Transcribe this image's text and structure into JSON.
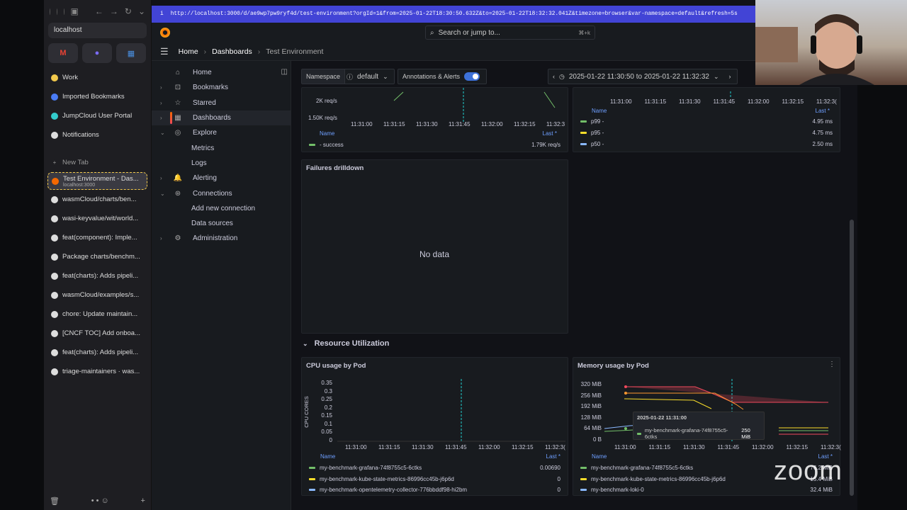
{
  "browser": {
    "url": "localhost",
    "pinned": [
      "gmail-icon",
      "arc-icon",
      "calendar-icon"
    ],
    "tabs": [
      {
        "label": "Work",
        "icon": "emoji-icon"
      },
      {
        "label": "Imported Bookmarks",
        "icon": "folder-icon"
      },
      {
        "label": "JumpCloud User Portal",
        "icon": "jumpcloud-icon"
      },
      {
        "label": "Notifications",
        "icon": "github-icon"
      },
      {
        "label": "New Tab",
        "icon": "plus-icon"
      },
      {
        "label": "Test Environment - Das...",
        "sub": "localhost:3000",
        "icon": "grafana-icon"
      },
      {
        "label": "wasmCloud/charts/ben...",
        "icon": "github-icon"
      },
      {
        "label": "wasi-keyvalue/wit/world...",
        "icon": "github-icon"
      },
      {
        "label": "feat(component): Imple...",
        "icon": "github-icon"
      },
      {
        "label": "Package charts/benchm...",
        "icon": "github-icon"
      },
      {
        "label": "feat(charts): Adds pipeli...",
        "icon": "github-icon"
      },
      {
        "label": "wasmCloud/examples/s...",
        "icon": "github-icon"
      },
      {
        "label": "chore: Update maintain...",
        "icon": "github-icon"
      },
      {
        "label": "[CNCF TOC] Add onboa...",
        "icon": "github-icon"
      },
      {
        "label": "feat(charts): Adds pipeli...",
        "icon": "github-icon"
      },
      {
        "label": "triage-maintainers · was...",
        "icon": "github-icon"
      }
    ]
  },
  "address": {
    "text": "http://localhost:3000/d/ae9wp7pw9ryf4d/test-environment?orgId=1&from=2025-01-22T18:30:50.632Z&to=2025-01-22T18:32:32.041Z&timezone=browser&var-namespace=default&refresh=5s"
  },
  "search": {
    "placeholder": "Search or jump to...",
    "shortcut": "⌘+k"
  },
  "breadcrumb": {
    "home": "Home",
    "dashboards": "Dashboards",
    "current": "Test Environment"
  },
  "nav": [
    {
      "label": "Home",
      "icon": "home-icon",
      "caret": false,
      "sub": false
    },
    {
      "label": "Bookmarks",
      "icon": "bookmark-icon",
      "caret": true,
      "sub": false
    },
    {
      "label": "Starred",
      "icon": "star-icon",
      "caret": true,
      "sub": false
    },
    {
      "label": "Dashboards",
      "icon": "apps-icon",
      "caret": true,
      "sub": false,
      "active": true
    },
    {
      "label": "Explore",
      "icon": "compass-icon",
      "caret": true,
      "sub": false,
      "open": true
    },
    {
      "label": "Metrics",
      "sub": true
    },
    {
      "label": "Logs",
      "sub": true
    },
    {
      "label": "Alerting",
      "icon": "bell-icon",
      "caret": true,
      "sub": false
    },
    {
      "label": "Connections",
      "icon": "link-icon",
      "caret": true,
      "sub": false,
      "open": true
    },
    {
      "label": "Add new connection",
      "sub": true
    },
    {
      "label": "Data sources",
      "sub": true
    },
    {
      "label": "Administration",
      "icon": "cog-icon",
      "caret": true,
      "sub": false
    }
  ],
  "controls": {
    "namespace_label": "Namespace",
    "namespace_value": "default",
    "annotations": "Annotations & Alerts",
    "time_range": "2025-01-22 11:30:50 to 2025-01-22 11:32:32"
  },
  "panels": {
    "requests": {
      "yticks": [
        "2K req/s",
        "1.50K req/s"
      ],
      "xticks": [
        "11:31:00",
        "11:31:15",
        "11:31:30",
        "11:31:45",
        "11:32:00",
        "11:32:15",
        "11:32:3"
      ],
      "legend_name": "Name",
      "legend_last": "Last *",
      "series": [
        {
          "name": "- success",
          "last": "1.79K req/s",
          "color": "#73bf69"
        }
      ]
    },
    "latency": {
      "xticks": [
        "11:31:00",
        "11:31:15",
        "11:31:30",
        "11:31:45",
        "11:32:00",
        "11:32:15",
        "11:32:3("
      ],
      "legend_name": "Name",
      "legend_last": "Last *",
      "series": [
        {
          "name": "p99 -",
          "last": "4.95 ms",
          "color": "#73bf69"
        },
        {
          "name": "p95 -",
          "last": "4.75 ms",
          "color": "#fade2a"
        },
        {
          "name": "p50 -",
          "last": "2.50 ms",
          "color": "#8ab8ff"
        }
      ]
    },
    "failures": {
      "title": "Failures drilldown",
      "nodata": "No data"
    },
    "row": {
      "title": "Resource Utilization"
    },
    "cpu": {
      "title": "CPU usage by Pod",
      "ylabel": "CPU CORES",
      "yticks": [
        "0.35",
        "0.3",
        "0.25",
        "0.2",
        "0.15",
        "0.1",
        "0.05",
        "0"
      ],
      "xticks": [
        "11:31:00",
        "11:31:15",
        "11:31:30",
        "11:31:45",
        "11:32:00",
        "11:32:15",
        "11:32:3("
      ],
      "legend_name": "Name",
      "legend_last": "Last *",
      "series": [
        {
          "name": "my-benchmark-grafana-74f8755c5-6ctks",
          "last": "0.00690",
          "color": "#73bf69"
        },
        {
          "name": "my-benchmark-kube-state-metrics-86996cc45b-j6p6d",
          "last": "0",
          "color": "#fade2a"
        },
        {
          "name": "my-benchmark-opentelemetry-collector-776bbddf98-hi2bm",
          "last": "0",
          "color": "#8ab8ff"
        }
      ]
    },
    "memory": {
      "title": "Memory usage by Pod",
      "yticks": [
        "320 MiB",
        "256 MiB",
        "192 MiB",
        "128 MiB",
        "64 MiB",
        "0 B"
      ],
      "xticks": [
        "11:31:00",
        "11:31:15",
        "11:31:30",
        "11:31:45",
        "11:32:00",
        "11:32:15",
        "11:32:3("
      ],
      "legend_name": "Name",
      "legend_last": "Last *",
      "tooltip_time": "2025-01-22 11:31:00",
      "tooltip_series": "my-benchmark-grafana-74f8755c5-6ctks",
      "tooltip_value": "250 MiB",
      "series": [
        {
          "name": "my-benchmark-grafana-74f8755c5-6ctks",
          "last": "76.2 MiB",
          "color": "#73bf69"
        },
        {
          "name": "my-benchmark-kube-state-metrics-86996cc45b-j6p6d",
          "last": "15.4 MiB",
          "color": "#fade2a"
        },
        {
          "name": "my-benchmark-loki-0",
          "last": "32.4 MiB",
          "color": "#8ab8ff"
        }
      ]
    }
  },
  "zoom": "zoom"
}
